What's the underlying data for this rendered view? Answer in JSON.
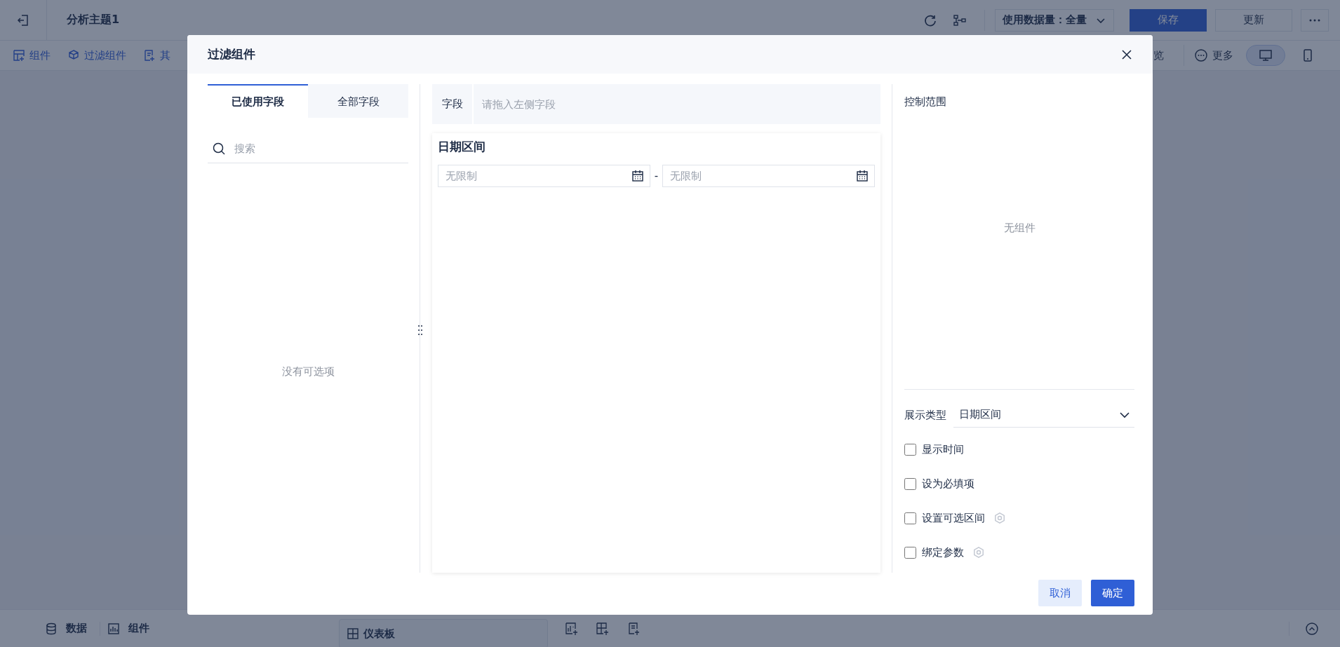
{
  "app": {
    "title": "分析主题1",
    "data_volume": "使用数据量：全量",
    "header_buttons": [
      {
        "label": "保存",
        "kind": "primary"
      },
      {
        "label": "更新",
        "kind": "plain"
      }
    ],
    "toolbar_left": [
      {
        "label": "组件",
        "kind": "widget"
      },
      {
        "label": "过滤组件",
        "kind": "filter"
      },
      {
        "label": "其",
        "kind": "other"
      }
    ],
    "toolbar_right": [
      {
        "label": "览",
        "kind": "preview"
      },
      {
        "label": "更多",
        "kind": "more"
      }
    ],
    "devices": [
      {
        "kind": "desktop",
        "selected": true
      },
      {
        "kind": "mobile",
        "selected": false
      }
    ],
    "bottom_tabs": [
      {
        "label": "数据",
        "kind": "data"
      },
      {
        "label": "组件",
        "kind": "chart"
      }
    ],
    "canvas_tab": "仪表板"
  },
  "dialog": {
    "title": "过滤组件",
    "tabs": [
      {
        "label": "已使用字段",
        "selected": true
      },
      {
        "label": "全部字段",
        "selected": false
      }
    ],
    "search": {
      "placeholder": "搜索"
    },
    "empty_fields": "没有可选项",
    "field_label": "字段",
    "field_placeholder": "请拖入左侧字段",
    "widget_title": "日期区间",
    "date_range": {
      "start_placeholder": "无限制",
      "separator": "-",
      "end_placeholder": "无限制"
    },
    "control_scope": {
      "title": "控制范围",
      "empty": "无组件"
    },
    "display_type": {
      "label": "展示类型",
      "value": "日期区间"
    },
    "options": [
      {
        "label": "显示时间",
        "checked": false,
        "has_settings": false
      },
      {
        "label": "设为必填项",
        "checked": false,
        "has_settings": false
      },
      {
        "label": "设置可选区间",
        "checked": false,
        "has_settings": true
      },
      {
        "label": "绑定参数",
        "checked": false,
        "has_settings": true
      }
    ],
    "buttons": [
      {
        "label": "取消",
        "kind": "secondary"
      },
      {
        "label": "确定",
        "kind": "primary"
      }
    ]
  }
}
